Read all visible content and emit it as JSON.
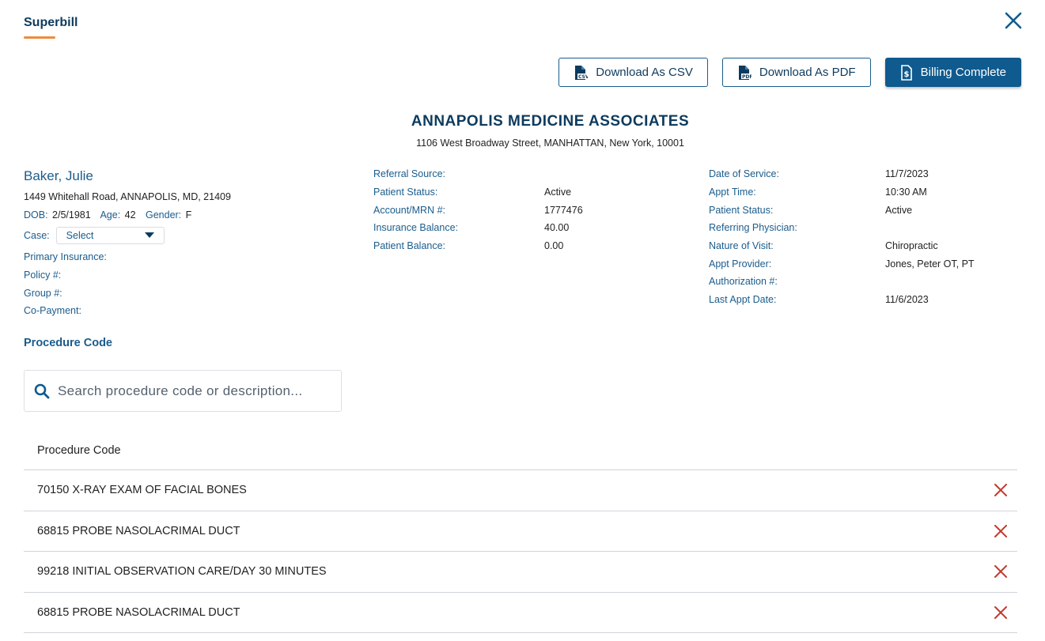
{
  "header": {
    "tab_title": "Superbill"
  },
  "toolbar": {
    "download_csv": "Download As CSV",
    "download_pdf": "Download As PDF",
    "billing_complete": "Billing Complete"
  },
  "practice": {
    "name": "ANNAPOLIS MEDICINE ASSOCIATES",
    "address": "1106 West Broadway Street, MANHATTAN, New York, 10001"
  },
  "patient": {
    "name": "Baker, Julie",
    "address": "1449 Whitehall Road, ANNAPOLIS, MD, 21409",
    "dob_label": "DOB:",
    "dob": "2/5/1981",
    "age_label": "Age:",
    "age": "42",
    "gender_label": "Gender:",
    "gender": "F",
    "case_label": "Case:",
    "case_value": "Select",
    "primary_insurance_label": "Primary Insurance:",
    "policy_label": "Policy #:",
    "group_label": "Group #:",
    "copayment_label": "Co-Payment:"
  },
  "account": [
    {
      "label": "Referral Source:",
      "value": ""
    },
    {
      "label": "Patient Status:",
      "value": "Active"
    },
    {
      "label": "Account/MRN #:",
      "value": "1777476"
    },
    {
      "label": "Insurance Balance:",
      "value": "40.00"
    },
    {
      "label": "Patient Balance:",
      "value": "0.00"
    }
  ],
  "appointment": [
    {
      "label": "Date of Service:",
      "value": "11/7/2023"
    },
    {
      "label": "Appt Time:",
      "value": "10:30 AM"
    },
    {
      "label": "Patient Status:",
      "value": "Active"
    },
    {
      "label": "Referring Physician:",
      "value": ""
    },
    {
      "label": "Nature of Visit:",
      "value": "Chiropractic"
    },
    {
      "label": "Appt Provider:",
      "value": "Jones, Peter OT, PT"
    },
    {
      "label": "Authorization #:",
      "value": ""
    },
    {
      "label": "Last Appt Date:",
      "value": "11/6/2023"
    }
  ],
  "procedures": {
    "section_title": "Procedure Code",
    "search_placeholder": "Search procedure code or description...",
    "column_header": "Procedure Code",
    "rows": [
      "70150 X-RAY EXAM OF FACIAL BONES",
      "68815 PROBE NASOLACRIMAL DUCT",
      "99218 INITIAL OBSERVATION CARE/DAY 30 MINUTES",
      "68815 PROBE NASOLACRIMAL DUCT"
    ]
  },
  "colors": {
    "primary": "#0f5a8e",
    "label": "#1a5c8c",
    "accent": "#f08a3c",
    "remove": "#c0392b"
  }
}
